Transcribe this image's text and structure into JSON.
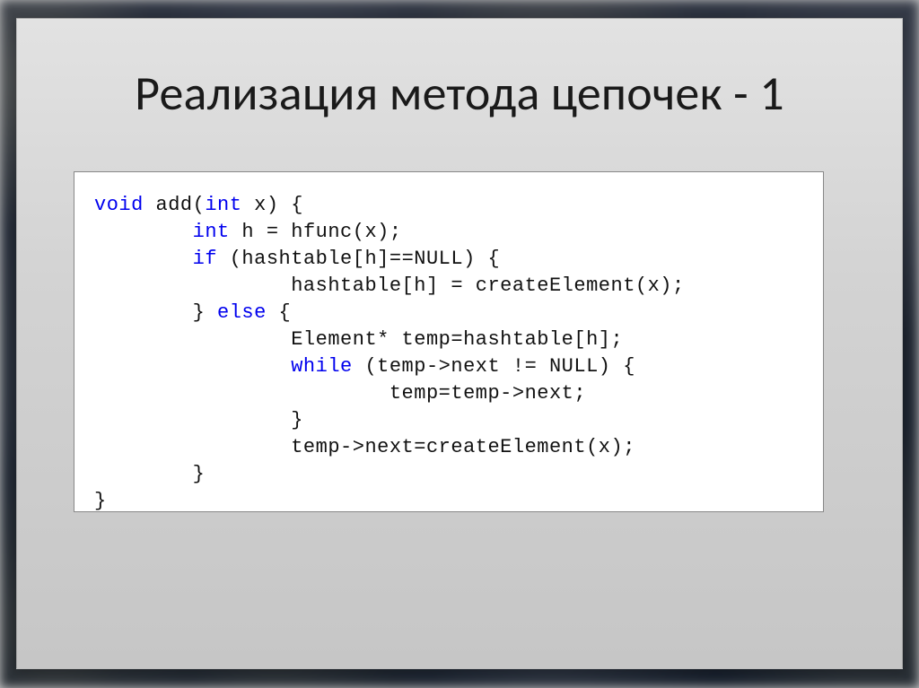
{
  "title": "Реализация метода цепочек - 1",
  "code": {
    "l1a": "void",
    "l1b": " add(",
    "l1c": "int",
    "l1d": " x) {",
    "l2a": "        ",
    "l2b": "int",
    "l2c": " h = hfunc(x);",
    "l3a": "        ",
    "l3b": "if",
    "l3c": " (hashtable[h]==NULL) {",
    "l4": "                hashtable[h] = createElement(x);",
    "l5a": "        } ",
    "l5b": "else",
    "l5c": " {",
    "l6": "                Element* temp=hashtable[h];",
    "l7a": "                ",
    "l7b": "while",
    "l7c": " (temp->next != NULL) {",
    "l8": "                        temp=temp->next;",
    "l9": "                }",
    "l10": "                temp->next=createElement(x);",
    "l11": "        }",
    "l12": "}"
  }
}
